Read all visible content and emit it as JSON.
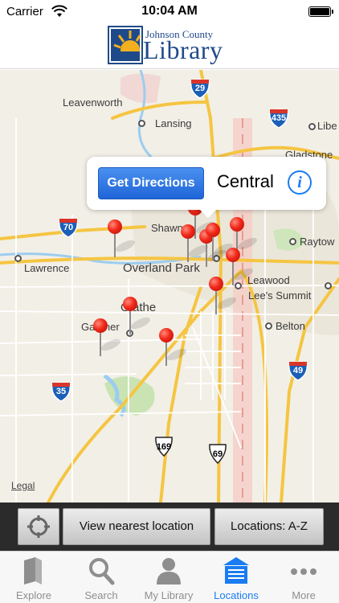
{
  "status_bar": {
    "carrier": "Carrier",
    "time": "10:04 AM"
  },
  "header": {
    "logo_line1": "Johnson County",
    "logo_line2": "Library"
  },
  "map": {
    "cities": {
      "leavenworth": "Leavenworth",
      "lansing": "Lansing",
      "liberty": "Libe",
      "gladstone": "Gladstone",
      "shawnee": "Shawnee",
      "raytown": "Raytow",
      "lawrence": "Lawrence",
      "overland_park": "Overland Park",
      "leawood": "Leawood",
      "lees_summit": "Lee's Summit",
      "olathe": "Olathe",
      "gardner": "Gardner",
      "belton": "Belton"
    },
    "shields": {
      "i29": "29",
      "i435": "435",
      "i70": "70",
      "i35": "35",
      "i49": "49",
      "us169": "169",
      "us69": "69"
    },
    "legal": "Legal"
  },
  "callout": {
    "directions_label": "Get Directions",
    "title": "Central",
    "info_label": "i"
  },
  "toolbar": {
    "nearest_label": "View nearest location",
    "az_label": "Locations: A-Z"
  },
  "tabs": [
    {
      "label": "Explore",
      "icon": "book-icon"
    },
    {
      "label": "Search",
      "icon": "search-icon"
    },
    {
      "label": "My Library",
      "icon": "person-icon"
    },
    {
      "label": "Locations",
      "icon": "building-icon"
    },
    {
      "label": "More",
      "icon": "more-icon"
    }
  ],
  "colors": {
    "accent": "#1a7cf2",
    "brand": "#1f4a89",
    "pin": "#f0281a",
    "highway": "#f5c542"
  }
}
